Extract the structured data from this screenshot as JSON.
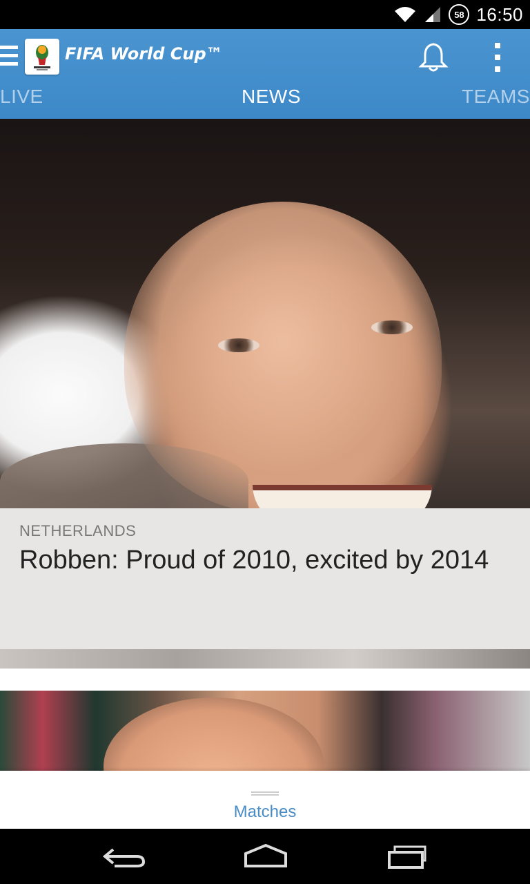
{
  "status_bar": {
    "time": "16:50",
    "battery_level": "58"
  },
  "app_bar": {
    "title": "FIFA World Cup™",
    "accent_color": "#4a94d0",
    "icons": [
      "menu-icon",
      "fifa-logo",
      "bell-icon",
      "overflow-menu-icon"
    ]
  },
  "tabs": [
    {
      "label": "LIVE",
      "selected": false
    },
    {
      "label": "NEWS",
      "selected": true
    },
    {
      "label": "TEAMS",
      "selected": false
    }
  ],
  "news": {
    "items": [
      {
        "category": "NETHERLANDS",
        "headline": "Robben: Proud of 2010, excited by 2014"
      }
    ]
  },
  "bottom_sheet": {
    "label": "Matches"
  },
  "nav_bar": {
    "icons": [
      "back-icon",
      "home-icon",
      "recents-icon"
    ]
  }
}
